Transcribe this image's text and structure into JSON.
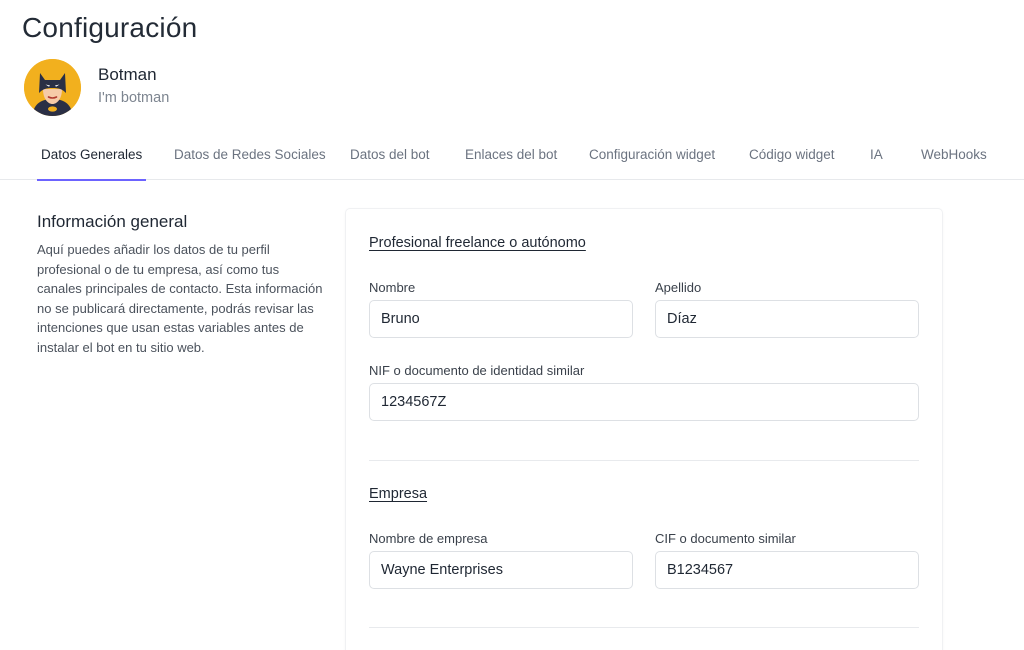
{
  "page": {
    "title": "Configuración"
  },
  "profile": {
    "name": "Botman",
    "subtitle": "I'm botman"
  },
  "tabs": [
    {
      "label": "Datos Generales",
      "active": true
    },
    {
      "label": "Datos de Redes Sociales",
      "active": false
    },
    {
      "label": "Datos del bot",
      "active": false
    },
    {
      "label": "Enlaces del bot",
      "active": false
    },
    {
      "label": "Configuración widget",
      "active": false
    },
    {
      "label": "Código widget",
      "active": false
    },
    {
      "label": "IA",
      "active": false
    },
    {
      "label": "WebHooks",
      "active": false
    }
  ],
  "info": {
    "title": "Información general",
    "description": "Aquí puedes añadir los datos de tu perfil profesional o de tu empresa, así como tus canales principales de contacto. Esta información no se publicará directamente, podrás revisar las intenciones que usan estas variables antes de instalar el bot en tu sitio web."
  },
  "freelance": {
    "title": "Profesional freelance o autónomo",
    "nombre_label": "Nombre",
    "nombre_value": "Bruno",
    "apellido_label": "Apellido",
    "apellido_value": "Díaz",
    "nif_label": "NIF o documento de identidad similar",
    "nif_value": "1234567Z"
  },
  "empresa": {
    "title": "Empresa",
    "nombre_label": "Nombre de empresa",
    "nombre_value": "Wayne Enterprises",
    "cif_label": "CIF o documento similar",
    "cif_value": "B1234567"
  },
  "colors": {
    "accent": "#6c63ff",
    "avatar_bg": "#f2b01e"
  },
  "icons": {
    "avatar": "batman-avatar-icon"
  }
}
